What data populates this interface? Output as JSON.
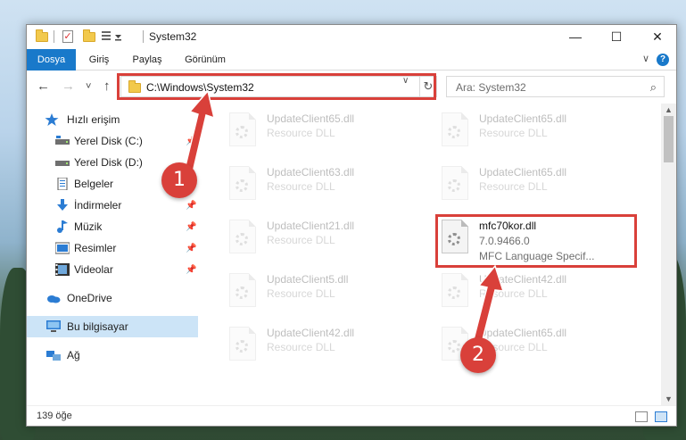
{
  "window": {
    "title": "System32",
    "controls": {
      "minimize": "—",
      "maximize": "☐",
      "close": "✕"
    }
  },
  "ribbon": {
    "tabs": [
      {
        "label": "Dosya",
        "active": true
      },
      {
        "label": "Giriş"
      },
      {
        "label": "Paylaş"
      },
      {
        "label": "Görünüm"
      }
    ],
    "help": "?",
    "expand": "∨"
  },
  "nav": {
    "back": "←",
    "forward": "→",
    "recent": "˅",
    "up": "↑",
    "address": "C:\\Windows\\System32",
    "address_dropdown": "∨",
    "refresh": "↻",
    "search_placeholder": "Ara: System32",
    "search_icon": "⌕"
  },
  "sidebar": {
    "items": [
      {
        "label": "Hızlı erişim",
        "icon": "star-icon"
      },
      {
        "label": "Yerel Disk (C:)",
        "icon": "drive-icon"
      },
      {
        "label": "Yerel Disk (D:)",
        "icon": "drive-icon"
      },
      {
        "label": "Belgeler",
        "icon": "documents-icon"
      },
      {
        "label": "İndirmeler",
        "icon": "download-icon"
      },
      {
        "label": "Müzik",
        "icon": "music-icon"
      },
      {
        "label": "Resimler",
        "icon": "pictures-icon"
      },
      {
        "label": "Videolar",
        "icon": "videos-icon"
      },
      {
        "label": "OneDrive",
        "icon": "cloud-icon"
      },
      {
        "label": "Bu bilgisayar",
        "icon": "computer-icon",
        "selected": true
      },
      {
        "label": "Ağ",
        "icon": "network-icon"
      }
    ],
    "pin": "📌"
  },
  "files": [
    {
      "name": "UpdateClient65.dll",
      "sub": "Resource DLL"
    },
    {
      "name": "UpdateClient65.dll",
      "sub": "Resource DLL"
    },
    {
      "name": "UpdateClient63.dll",
      "sub": "Resource DLL"
    },
    {
      "name": "UpdateClient65.dll",
      "sub": "Resource DLL"
    },
    {
      "name": "UpdateClient21.dll",
      "sub": "Resource DLL"
    },
    {
      "name": "mfc70kor.dll",
      "sub": "7.0.9466.0",
      "sub2": "MFC Language Specif..."
    },
    {
      "name": "UpdateClient5.dll",
      "sub": "Resource DLL"
    },
    {
      "name": "UpdateClient42.dll",
      "sub": "Resource DLL"
    },
    {
      "name": "UpdateClient42.dll",
      "sub": "Resource DLL"
    },
    {
      "name": "UpdateClient65.dll",
      "sub": "Resource DLL"
    }
  ],
  "status": {
    "count": "139 öğe"
  },
  "callouts": {
    "one": "1",
    "two": "2"
  },
  "colors": {
    "accent": "#1979ca",
    "highlight": "#d9403a",
    "selected": "#cce4f7"
  }
}
